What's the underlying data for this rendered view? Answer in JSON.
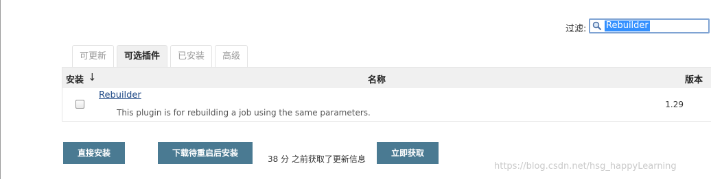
{
  "filter": {
    "label": "过滤:",
    "value": "Rebuilder"
  },
  "tabs": [
    {
      "label": "可更新",
      "active": false
    },
    {
      "label": "可选插件",
      "active": true
    },
    {
      "label": "已安装",
      "active": false
    },
    {
      "label": "高级",
      "active": false
    }
  ],
  "table": {
    "headers": {
      "install": "安装",
      "sort_arrow": "↓",
      "name": "名称",
      "version": "版本"
    },
    "rows": [
      {
        "name": "Rebuilder",
        "description": "This plugin is for rebuilding a job using the same parameters.",
        "version": "1.29",
        "checked": false
      }
    ]
  },
  "actions": {
    "install_now": "直接安装",
    "download_restart": "下载待重启后安装",
    "update_info": "38 分 之前获取了更新信息",
    "check_now": "立即获取"
  },
  "watermark": "https://blog.csdn.net/hsg_happyLearning",
  "colors": {
    "button_bg": "#4a7a92",
    "link": "#204a87",
    "selection": "#3390ff"
  },
  "icons": {
    "filter": "search-icon"
  }
}
